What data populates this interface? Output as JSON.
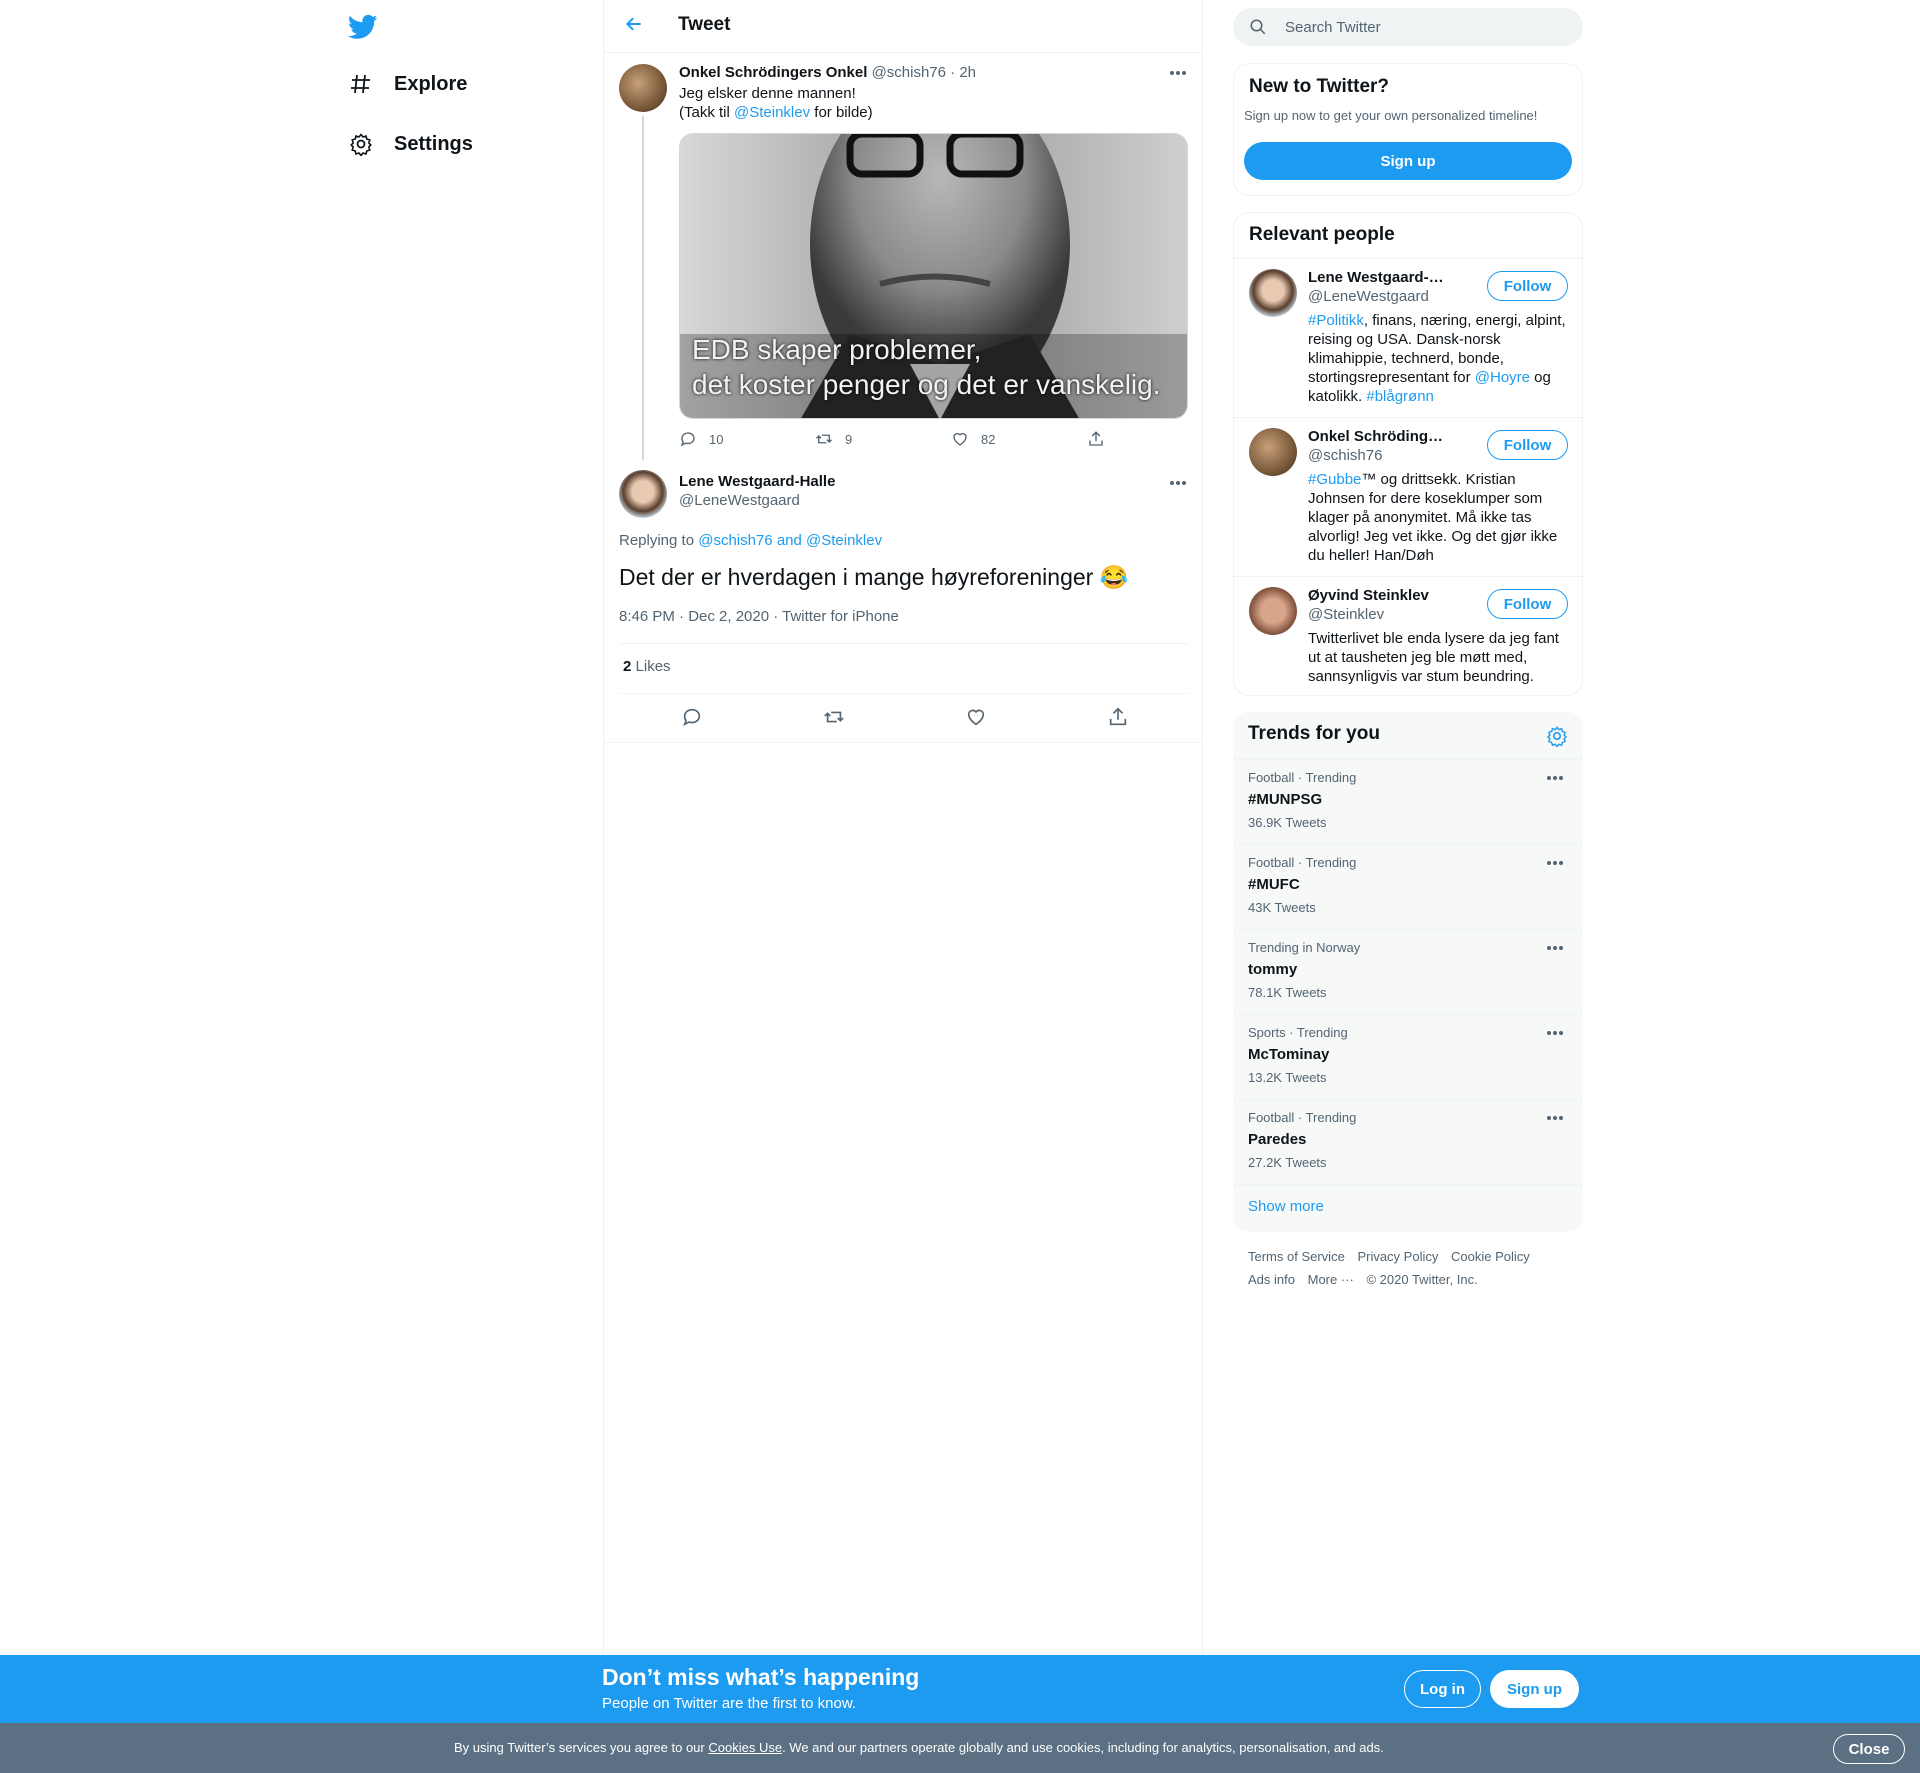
{
  "nav": {
    "items": [
      {
        "label": "Explore",
        "icon": "hashtag-icon"
      },
      {
        "label": "Settings",
        "icon": "gear-icon"
      }
    ]
  },
  "header": {
    "title": "Tweet"
  },
  "tweet1": {
    "name": "Onkel Schrödingers Onkel",
    "handle": "@schish76",
    "time": "· 2h",
    "line1": "Jeg elsker denne mannen!",
    "line2_pre": "(Takk til ",
    "line2_mention": "@Steinklev",
    "line2_post": " for bilde)",
    "media_caption_1": "EDB skaper problemer,",
    "media_caption_2": "det koster penger og det er vanskelig.",
    "replies": "10",
    "retweets": "9",
    "likes": "82"
  },
  "tweet2": {
    "name": "Lene Westgaard-Halle",
    "handle": "@LeneWestgaard",
    "replying_label": "Replying to ",
    "replying_to": "@schish76 and @Steinklev",
    "text": "Det der er hverdagen i mange høyreforeninger 😂",
    "meta": "8:46 PM · Dec 2, 2020 · Twitter for iPhone",
    "likes_count": "2",
    "likes_label": "Likes"
  },
  "sidebar": {
    "search_placeholder": "Search Twitter",
    "new_title": "New to Twitter?",
    "new_sub": "Sign up now to get your own personalized timeline!",
    "signup_label": "Sign up",
    "relevant_title": "Relevant people",
    "follow_label": "Follow",
    "people": [
      {
        "name": "Lene Westgaard-Halle",
        "handle": "@LeneWestgaard",
        "bio_a": "#Politikk",
        "bio_b": ", finans, næring, energi, alpint, reising og USA. Dansk-norsk klimahippie, technerd, bonde, stortingsrepresentant for ",
        "bio_c": "@Hoyre",
        "bio_d": " og katolikk. ",
        "bio_e": "#blågrønn"
      },
      {
        "name": "Onkel Schrödingers Onkel",
        "handle": "@schish76",
        "bio_a": "#Gubbe",
        "bio_b": "™ og drittsekk. Kristian Johnsen for dere koseklumper som klager på anonymitet. Må ikke tas alvorlig! Jeg vet ikke. Og det gjør ikke du heller! Han/Døh"
      },
      {
        "name": "Øyvind Steinklev",
        "handle": "@Steinklev",
        "bio": "Twitterlivet ble enda lysere da jeg fant ut at tausheten jeg ble møtt med, sannsynligvis var stum beundring."
      }
    ],
    "trends_title": "Trends for you",
    "trends": [
      {
        "context": "Football · Trending",
        "name": "#MUNPSG",
        "count": "36.9K Tweets"
      },
      {
        "context": "Football · Trending",
        "name": "#MUFC",
        "count": "43K Tweets"
      },
      {
        "context": "Trending in Norway",
        "name": "tommy",
        "count": "78.1K Tweets"
      },
      {
        "context": "Sports · Trending",
        "name": "McTominay",
        "count": "13.2K Tweets"
      },
      {
        "context": "Football · Trending",
        "name": "Paredes",
        "count": "27.2K Tweets"
      }
    ],
    "show_more": "Show more",
    "footer": {
      "terms": "Terms of Service",
      "privacy": "Privacy Policy",
      "cookie": "Cookie Policy",
      "ads": "Ads info",
      "more": "More ···",
      "copyright": "© 2020 Twitter, Inc."
    }
  },
  "bottom_bar": {
    "title": "Don’t miss what’s happening",
    "subtitle": "People on Twitter are the first to know.",
    "login": "Log in",
    "signup": "Sign up"
  },
  "cookie_bar": {
    "pre": "By using Twitter’s services you agree to our ",
    "link": "Cookies Use",
    "post": ". We and our partners operate globally and use cookies, including for analytics, personalisation, and ads.",
    "close": "Close"
  },
  "colors": {
    "accent": "#1d9bf0",
    "cookie_bg": "#5b7083"
  }
}
